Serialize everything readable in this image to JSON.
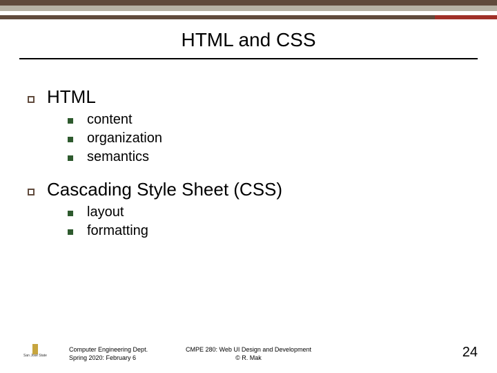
{
  "title": "HTML and CSS",
  "bullets": [
    {
      "label": "HTML",
      "sub": [
        "content",
        "organization",
        "semantics"
      ]
    },
    {
      "label": "Cascading Style Sheet (CSS)",
      "sub": [
        "layout",
        "formatting"
      ]
    }
  ],
  "footer": {
    "logo_text": "San José State",
    "left_line1": "Computer Engineering Dept.",
    "left_line2": "Spring 2020: February 6",
    "center_line1": "CMPE 280: Web UI Design and Development",
    "center_line2": "© R. Mak",
    "page_number": "24"
  }
}
